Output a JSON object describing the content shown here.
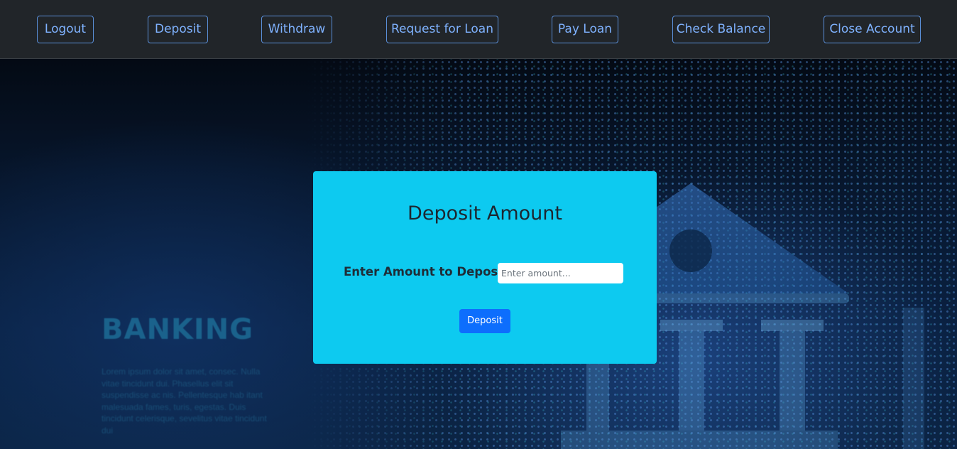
{
  "nav": {
    "items": [
      {
        "label": "Logout"
      },
      {
        "label": "Deposit"
      },
      {
        "label": "Withdraw"
      },
      {
        "label": "Request for Loan"
      },
      {
        "label": "Pay Loan"
      },
      {
        "label": "Check Balance"
      },
      {
        "label": "Close Account"
      }
    ]
  },
  "background": {
    "word": "BANKING",
    "lorem": "Lorem ipsum dolor sit amet, consec. Nulla vitae tincidunt dui. Phasellus elit sit suspendisse ac nis. Pellentesque hab itant malesuada fames, turis, egestas. Duis tincidunt celerisque, sevelitus vitae tincidunt dui"
  },
  "form": {
    "title": "Deposit Amount",
    "label": "Enter Amount to Deposit :",
    "placeholder": "Enter amount...",
    "value": "",
    "submit_label": "Deposit"
  },
  "colors": {
    "navbar_bg": "#212529",
    "nav_button_border": "#5a8fd8",
    "nav_button_text": "#7fb2ff",
    "card_bg": "#0dcaf0",
    "submit_bg": "#0d6efd"
  }
}
